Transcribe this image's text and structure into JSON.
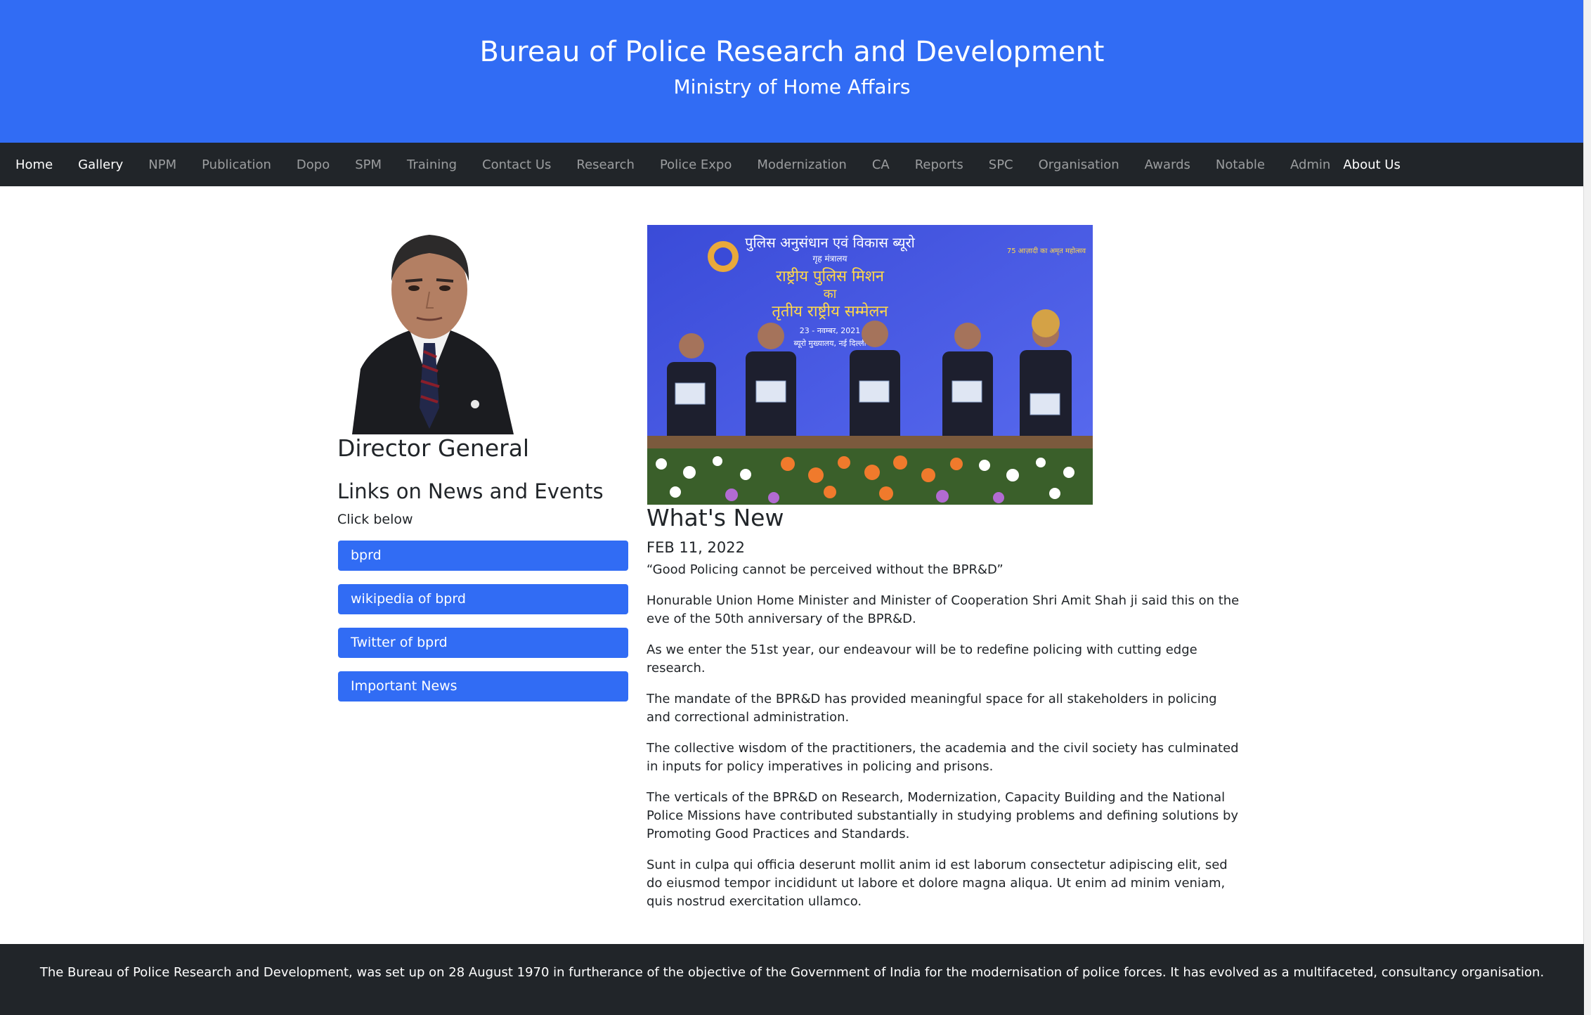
{
  "header": {
    "title": "Bureau of Police Research and Development",
    "subtitle": "Ministry of Home Affairs",
    "bg_color": "#316cf4"
  },
  "nav": {
    "items": [
      "Home",
      "Gallery",
      "NPM",
      "Publication",
      "Dopo",
      "SPM",
      "Training",
      "Contact Us",
      "Research",
      "Police Expo",
      "Modernization",
      "CA",
      "Reports",
      "SPC",
      "Organisation",
      "Awards",
      "Notable",
      "Admin",
      "About Us"
    ]
  },
  "sidebar": {
    "dg_title": "Director General",
    "links_title": "Links on News and Events",
    "click_below": "Click below",
    "links": [
      "bprd",
      "wikipedia of bprd",
      "Twitter of bprd",
      "Important News"
    ]
  },
  "event_image": {
    "banner_lines": [
      "पुलिस अनुसंधान एवं विकास ब्यूरो",
      "गृह मंत्रालय",
      "राष्ट्रीय पुलिस मिशन",
      "का",
      "तृतीय राष्ट्रीय सम्मेलन",
      "23 - नवम्बर, 2021",
      "ब्यूरो मुख्यालय, नई दिल्ली"
    ],
    "logo_text": "75 आज़ादी का अमृत महोत्सव"
  },
  "whats_new": {
    "title": "What's New",
    "date": "FEB 11, 2022",
    "paragraphs": [
      "“Good Policing cannot be perceived without the BPR&D”",
      "Honurable Union Home Minister and Minister of Cooperation Shri Amit Shah ji said this on the eve of the 50th anniversary of the BPR&D.",
      "As we enter the 51st year, our endeavour will be to redefine policing with cutting edge research.",
      "The mandate of the BPR&D has provided meaningful space for all stakeholders in policing and correctional administration.",
      "The collective wisdom of the practitioners, the academia and the civil society has culminated in inputs for policy imperatives in policing and prisons.",
      "The verticals of the BPR&D on Research, Modernization, Capacity Building and the National Police Missions have contributed substantially in studying problems and defining solutions by Promoting Good Practices and Standards.",
      "Sunt in culpa qui officia deserunt mollit anim id est laborum consectetur adipiscing elit, sed do eiusmod tempor incididunt ut labore et dolore magna aliqua. Ut enim ad minim veniam, quis nostrud exercitation ullamco."
    ]
  },
  "footer": {
    "text": "The Bureau of Police Research and Development, was set up on 28 August 1970 in furtherance of the objective of the Government of India for the modernisation of police forces. It has evolved as a multifaceted, consultancy organisation."
  }
}
